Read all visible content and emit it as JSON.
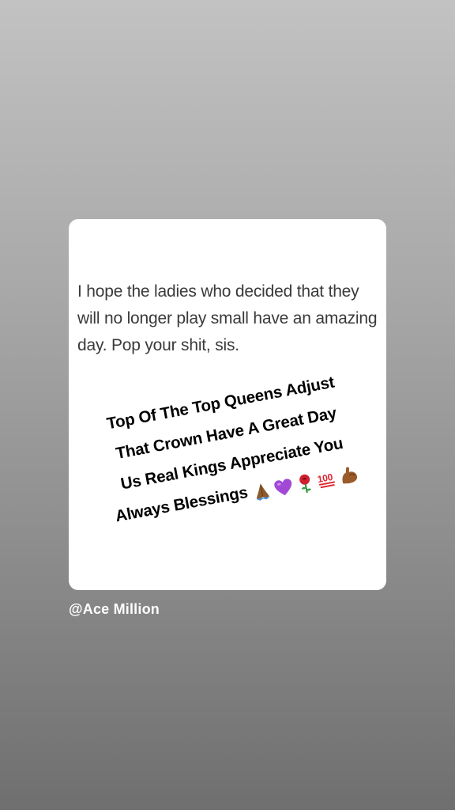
{
  "story": {
    "quote_text": "I hope the ladies who decided that they will no longer play small have an amazing day. Pop your shit, sis.",
    "caption_lines": [
      "Top Of The Top Queens Adjust",
      "That Crown Have A Great Day",
      "Us Real Kings Appreciate You",
      "Always Blessings"
    ],
    "caption_emojis": [
      "praying-hands-icon",
      "purple-heart-icon",
      "rose-icon",
      "hundred-points-icon",
      "flexed-biceps-icon"
    ],
    "attribution": "@Ace Million"
  },
  "colors": {
    "background_top": "#c2c2c2",
    "background_bottom": "#6f6f6f",
    "card": "#ffffff",
    "quote_text": "#3a3a3a",
    "caption_text": "#000000",
    "attribution_text": "#ffffff"
  }
}
